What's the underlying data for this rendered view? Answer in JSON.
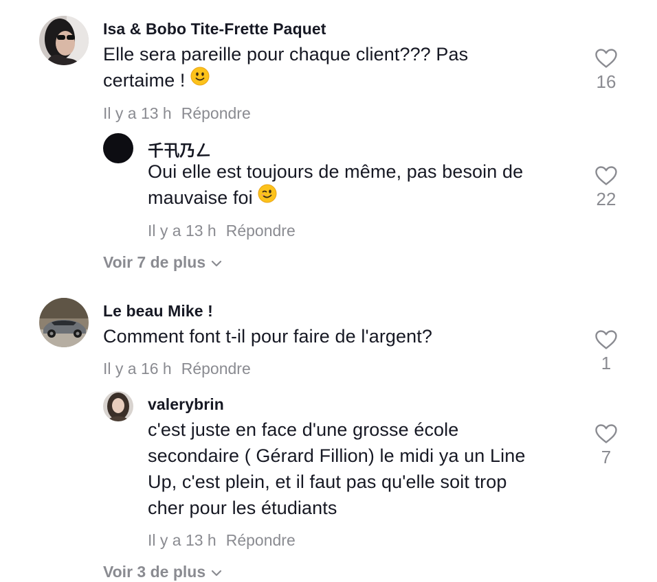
{
  "comments": [
    {
      "username": "Isa & Bobo Tite-Frette Paquet",
      "line1": "Elle sera pareille pour chaque client??? Pas",
      "line2": "certaime !",
      "emoji": "slightly-smiling-face",
      "time": "Il y a 13 h",
      "reply_label": "Répondre",
      "likes": "16",
      "replies": [
        {
          "username": "千卂乃ㄥ",
          "line1": "Oui elle est toujours de même, pas besoin de",
          "line2": "mauvaise foi",
          "emoji": "winking-face",
          "time": "Il y a 13 h",
          "reply_label": "Répondre",
          "likes": "22"
        }
      ],
      "view_more": "Voir 7 de plus"
    },
    {
      "username": "Le beau Mike !",
      "line1": "Comment font t-il pour faire de l'argent?",
      "time": "Il y a 16 h",
      "reply_label": "Répondre",
      "likes": "1",
      "replies": [
        {
          "username": "valerybrin",
          "line1": "c'est juste en face d'une grosse école",
          "line2": "secondaire ( Gérard Fillion) le midi ya un Line",
          "line3": "Up, c'est plein, et il faut pas qu'elle soit trop",
          "line4": "cher pour les étudiants",
          "time": "Il y a 13 h",
          "reply_label": "Répondre",
          "likes": "7"
        }
      ],
      "view_more": "Voir 3 de plus"
    }
  ],
  "colors": {
    "text": "#161823",
    "muted": "#8a8b91",
    "background": "#ffffff"
  },
  "icons": [
    "heart-outline-icon",
    "chevron-down-icon"
  ]
}
